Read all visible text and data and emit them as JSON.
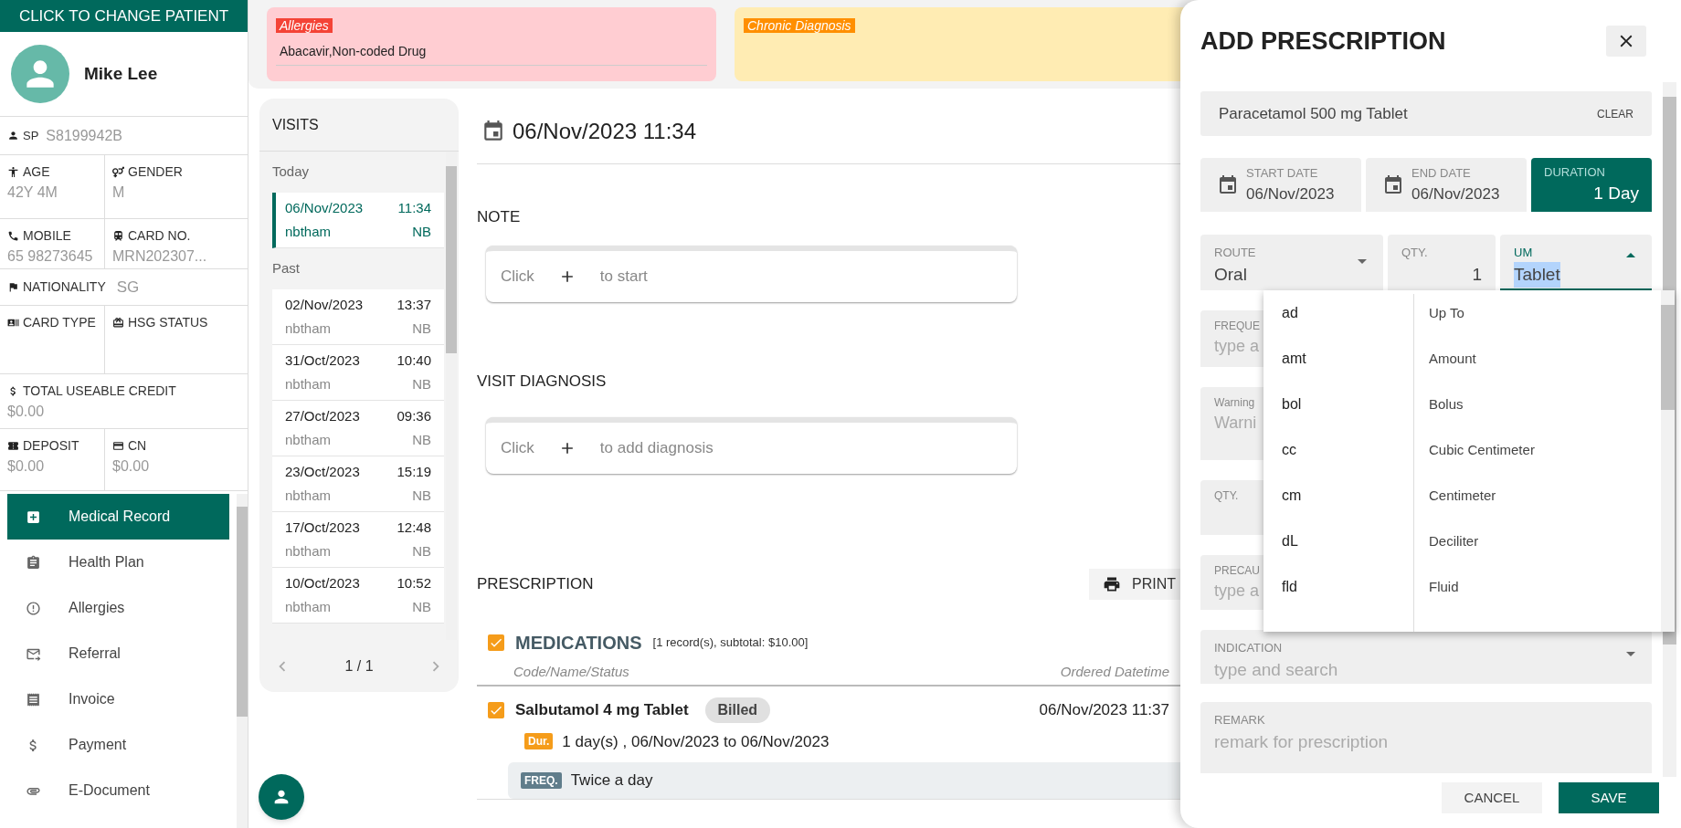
{
  "patient_banner": {
    "label": "CLICK TO CHANGE PATIENT"
  },
  "patient": {
    "name": "Mike Lee",
    "id_label": "SP",
    "id_value": "S8199942B",
    "rows": [
      [
        {
          "label": "AGE",
          "value": "42Y 4M"
        },
        {
          "label": "GENDER",
          "value": "M"
        }
      ],
      [
        {
          "label": "MOBILE",
          "value": "65 98273645"
        },
        {
          "label": "CARD NO.",
          "value": "MRN202307..."
        }
      ],
      [
        {
          "label": "NATIONALITY",
          "value": "SG",
          "kind": "inline"
        }
      ],
      [
        {
          "label": "CARD TYPE"
        },
        {
          "label": "HSG STATUS"
        }
      ],
      [
        {
          "label": "TOTAL USEABLE CREDIT",
          "value": "$0.00"
        }
      ],
      [
        {
          "label": "DEPOSIT",
          "value": "$0.00"
        },
        {
          "label": "CN",
          "value": "$0.00"
        }
      ]
    ]
  },
  "menu": [
    {
      "label": "Medical Record",
      "selected": true
    },
    {
      "label": "Health Plan",
      "selected": false
    },
    {
      "label": "Allergies",
      "selected": false
    },
    {
      "label": "Referral",
      "selected": false
    },
    {
      "label": "Invoice",
      "selected": false
    },
    {
      "label": "Payment",
      "selected": false
    },
    {
      "label": "E-Document",
      "selected": false
    }
  ],
  "alerts": [
    {
      "kind": "allergy",
      "label": "Allergies",
      "text": "Abacavir,Non-coded Drug"
    },
    {
      "kind": "chronic",
      "label": "Chronic Diagnosis"
    }
  ],
  "visits": {
    "title": "VISITS",
    "groups": [
      {
        "label": "Today",
        "items": [
          {
            "date": "06/Nov/2023",
            "time": "11:34",
            "user": "nbtham",
            "initials": "NB",
            "selected": true
          }
        ]
      },
      {
        "label": "Past",
        "items": [
          {
            "date": "02/Nov/2023",
            "time": "13:37",
            "user": "nbtham",
            "initials": "NB",
            "selected": false
          },
          {
            "date": "31/Oct/2023",
            "time": "10:40",
            "user": "nbtham",
            "initials": "NB",
            "selected": false
          },
          {
            "date": "27/Oct/2023",
            "time": "09:36",
            "user": "nbtham",
            "initials": "NB",
            "selected": false
          },
          {
            "date": "23/Oct/2023",
            "time": "15:19",
            "user": "nbtham",
            "initials": "NB",
            "selected": false
          },
          {
            "date": "17/Oct/2023",
            "time": "12:48",
            "user": "nbtham",
            "initials": "NB",
            "selected": false
          },
          {
            "date": "10/Oct/2023",
            "time": "10:52",
            "user": "nbtham",
            "initials": "NB",
            "selected": false
          }
        ]
      }
    ],
    "pager": "1 / 1"
  },
  "visit": {
    "datetime": "06/Nov/2023 11:34",
    "note": {
      "title": "NOTE",
      "click": "Click",
      "rest": "to start"
    },
    "diagnosis": {
      "title": "VISIT DIAGNOSIS",
      "click": "Click",
      "rest": "to add diagnosis"
    },
    "prescription": {
      "title": "PRESCRIPTION",
      "print": "PRINT",
      "group": {
        "checked": true,
        "title": "MEDICATIONS",
        "summary": "[1 record(s), subtotal: $10.00]",
        "column_1": "Code/Name/Status",
        "column_2": "Ordered Datetime",
        "items": [
          {
            "checked": true,
            "name": "Salbutamol 4 mg Tablet",
            "status": "Billed",
            "ordered": "06/Nov/2023 11:37",
            "duration_badge": "Dur.",
            "duration": "1 day(s) , 06/Nov/2023 to 06/Nov/2023",
            "frequency_badge": "FREQ.",
            "frequency": "Twice a day"
          }
        ]
      }
    }
  },
  "panel": {
    "title": "ADD PRESCRIPTION",
    "drug": {
      "value": "Paracetamol 500 mg Tablet",
      "clear": "CLEAR"
    },
    "start_date": {
      "label": "START DATE",
      "value": "06/Nov/2023"
    },
    "end_date": {
      "label": "END DATE",
      "value": "06/Nov/2023"
    },
    "duration": {
      "label": "DURATION",
      "value": "1 Day"
    },
    "route": {
      "label": "ROUTE",
      "value": "Oral"
    },
    "qty": {
      "label": "QTY.",
      "value": "1"
    },
    "um": {
      "label": "UM",
      "value": "Tablet",
      "expanded": true
    },
    "um_options": [
      {
        "code": "ad",
        "name": "Up To"
      },
      {
        "code": "amt",
        "name": "Amount"
      },
      {
        "code": "bol",
        "name": "Bolus"
      },
      {
        "code": "cc",
        "name": "Cubic Centimeter"
      },
      {
        "code": "cm",
        "name": "Centimeter"
      },
      {
        "code": "dL",
        "name": "Deciliter"
      },
      {
        "code": "fld",
        "name": "Fluid"
      }
    ],
    "covered_fields": [
      {
        "label": "FREQUE",
        "placeholder": "type a"
      },
      {
        "label": "Warning",
        "placeholder": "Warni"
      },
      {
        "label": "QTY."
      },
      {
        "label": "PRECAU",
        "placeholder": "type a"
      }
    ],
    "indication": {
      "label": "INDICATION",
      "placeholder": "type and search"
    },
    "remark": {
      "label": "REMARK",
      "placeholder": "remark for prescription"
    },
    "cancel": "CANCEL",
    "save": "SAVE"
  }
}
